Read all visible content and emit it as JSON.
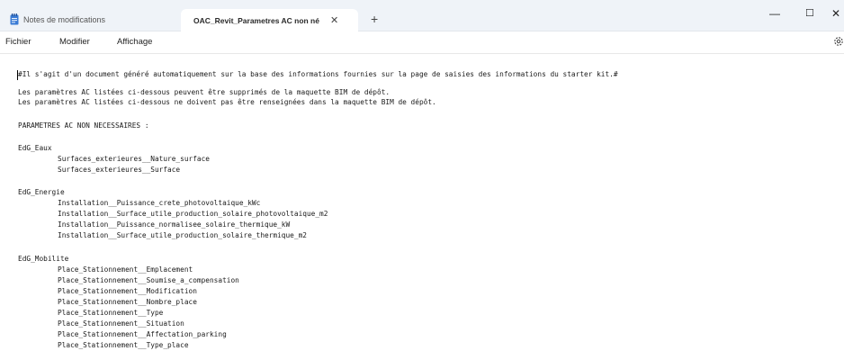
{
  "tabs": {
    "inactive_label": "Notes de modifications",
    "active_label": "OAC_Revit_Parametres AC non néc",
    "close_glyph": "✕",
    "new_tab_glyph": "+"
  },
  "window_controls": {
    "minimize": "—",
    "maximize": "☐",
    "close": "✕"
  },
  "menu": {
    "file": "Fichier",
    "edit": "Modifier",
    "view": "Affichage"
  },
  "icons": {
    "app": "notepad-icon",
    "settings": "gear-icon"
  },
  "colors": {
    "titlebar": "#eff3f8",
    "app_icon": "#3a7bd5"
  },
  "document": {
    "header": "#Il s'agit d'un document généré automatiquement sur la base des informations fournies sur la page de saisies des informations du starter kit.#",
    "intro_1": "Les paramètres AC listées ci-dessous peuvent être supprimés de la maquette BIM de dépôt.",
    "intro_2": "Les paramètres AC listées ci-dessous ne doivent pas être renseignées dans la maquette BIM de dépôt.",
    "section_title": "PARAMETRES AC NON NECESSAIRES :",
    "groups": [
      {
        "name": "EdG_Eaux",
        "items": [
          "Surfaces_exterieures__Nature_surface",
          "Surfaces_exterieures__Surface"
        ]
      },
      {
        "name": "EdG_Energie",
        "items": [
          "Installation__Puissance_crete_photovoltaique_kWc",
          "Installation__Surface_utile_production_solaire_photovoltaique_m2",
          "Installation__Puissance_normalisee_solaire_thermique_kW",
          "Installation__Surface_utile_production_solaire_thermique_m2"
        ]
      },
      {
        "name": "EdG_Mobilite",
        "items": [
          "Place_Stationnement__Emplacement",
          "Place_Stationnement__Soumise_a_compensation",
          "Place_Stationnement__Modification",
          "Place_Stationnement__Nombre_place",
          "Place_Stationnement__Type",
          "Place_Stationnement__Situation",
          "Place_Stationnement__Affectation_parking",
          "Place_Stationnement__Type_place"
        ]
      }
    ]
  }
}
